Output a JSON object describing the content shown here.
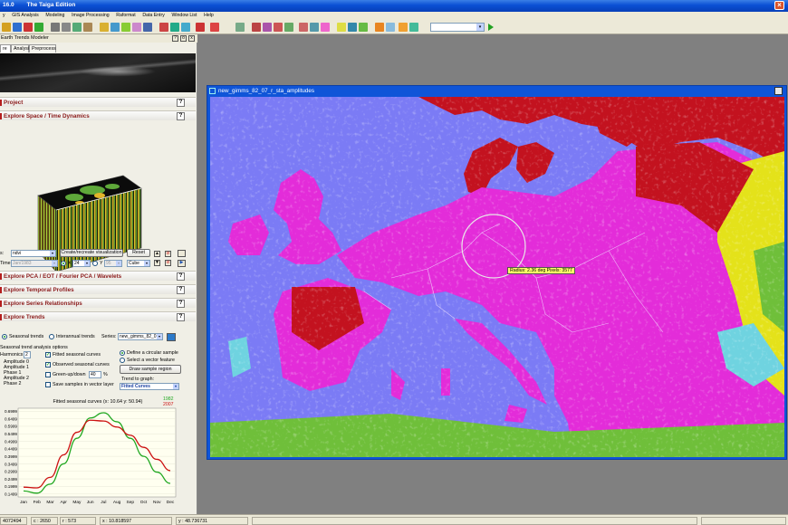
{
  "app": {
    "version": "16.0",
    "edition": "The Taiga Edition",
    "close_glyph": "×"
  },
  "menus": [
    "y",
    "GIS Analysis",
    "Modeling",
    "Image Processing",
    "Raformat",
    "Data Entry",
    "Window List",
    "Help"
  ],
  "toolbar": {
    "combo_value": "",
    "combo_arrow": "▾"
  },
  "left_panel": {
    "title": "Earth Trends Modeler",
    "header_buttons": [
      "?",
      "o",
      "x"
    ],
    "tabs": [
      "re",
      "Analysis",
      "Preprocess"
    ],
    "sections": {
      "project": "Project",
      "space_time": "Explore Space / Time Dynamics",
      "pca": "Explore PCA / EOT / Fourier PCA / Wavelets",
      "temporal": "Explore Temporal Profiles",
      "series": "Explore Series Relationships",
      "trends": "Explore Trends"
    },
    "help_glyph": "?",
    "viz": {
      "series_label": "s:",
      "series_value": "ndvi",
      "create_button": "Create/recreate visualization",
      "reset_button": "Reset",
      "time_label": "Time",
      "time_value": "Jan/1983",
      "x_label": "X",
      "x_value": "24",
      "y_label": "Y",
      "y_value": "95",
      "mode_value": "Cube",
      "arrow_glyph": "▾",
      "nav": [
        "▲",
        "⊘",
        "▼",
        "⊘",
        "▶"
      ]
    },
    "trends": {
      "seasonal_label": "Seasonal trends",
      "interannual_label": "Interannual trends",
      "series_label": "Series:",
      "series_value": "new_gimms_82_0",
      "options_title": "Seasonal trend analysis options",
      "harmonics_label": "Harmonics",
      "harmonics_value": "2",
      "amplitude_items": [
        "Amplitude 0",
        "Amplitude 1",
        "Phase 1",
        "Amplitude 2",
        "Phase 2"
      ],
      "fitted_label": "Fitted seasonal curves",
      "observed_label": "Observed seasonal curves",
      "greenup_label": "Green-up/down",
      "greenup_value": "40",
      "greenup_unit": "%",
      "save_label": "Save samples in vector layer",
      "circular_label": "Define a circular sample",
      "vector_label": "Select a vector feature",
      "draw_button": "Draw sample region",
      "trend_label": "Trend to graph:",
      "trend_value": "Fitted Curves",
      "check_glyph": "✓"
    }
  },
  "chart_data": {
    "type": "line",
    "title": "Fitted seasonal curves  (x: 10.64  y: 50.94)",
    "categories": [
      "Jan",
      "Feb",
      "Mar",
      "Apr",
      "May",
      "Jun",
      "Jul",
      "Aug",
      "Sep",
      "Oct",
      "Nov",
      "Dec"
    ],
    "yticks": [
      "0.6999",
      "0.6499",
      "0.5999",
      "0.5499",
      "0.4999",
      "0.4499",
      "0.3999",
      "0.3499",
      "0.2999",
      "0.2499",
      "0.1999",
      "0.1499"
    ],
    "ylim": [
      0.1299,
      0.7199
    ],
    "series": [
      {
        "name": "1982",
        "color": "#22a822",
        "values": [
          0.17,
          0.155,
          0.215,
          0.35,
          0.52,
          0.655,
          0.69,
          0.63,
          0.52,
          0.4,
          0.295,
          0.22
        ]
      },
      {
        "name": "2007",
        "color": "#cc1111",
        "values": [
          0.195,
          0.19,
          0.26,
          0.41,
          0.56,
          0.64,
          0.635,
          0.595,
          0.54,
          0.46,
          0.38,
          0.305
        ]
      }
    ]
  },
  "map_window": {
    "title": "new_gimms_82_07_r_sta_amplitudes",
    "tooltip": "Radius: 2.36 deg  Pixels: 3577"
  },
  "status": [
    "4072494",
    "c : 2650",
    "r : 573",
    "x : 10.818597",
    "y : 48.736731"
  ],
  "colors": {
    "water": "#7b7bf5",
    "land_main": "#e32cd9",
    "land_red": "#c3121f",
    "land_green": "#6fbf3a",
    "land_yellow": "#e4e21a",
    "land_cyan": "#6fd3e0"
  }
}
